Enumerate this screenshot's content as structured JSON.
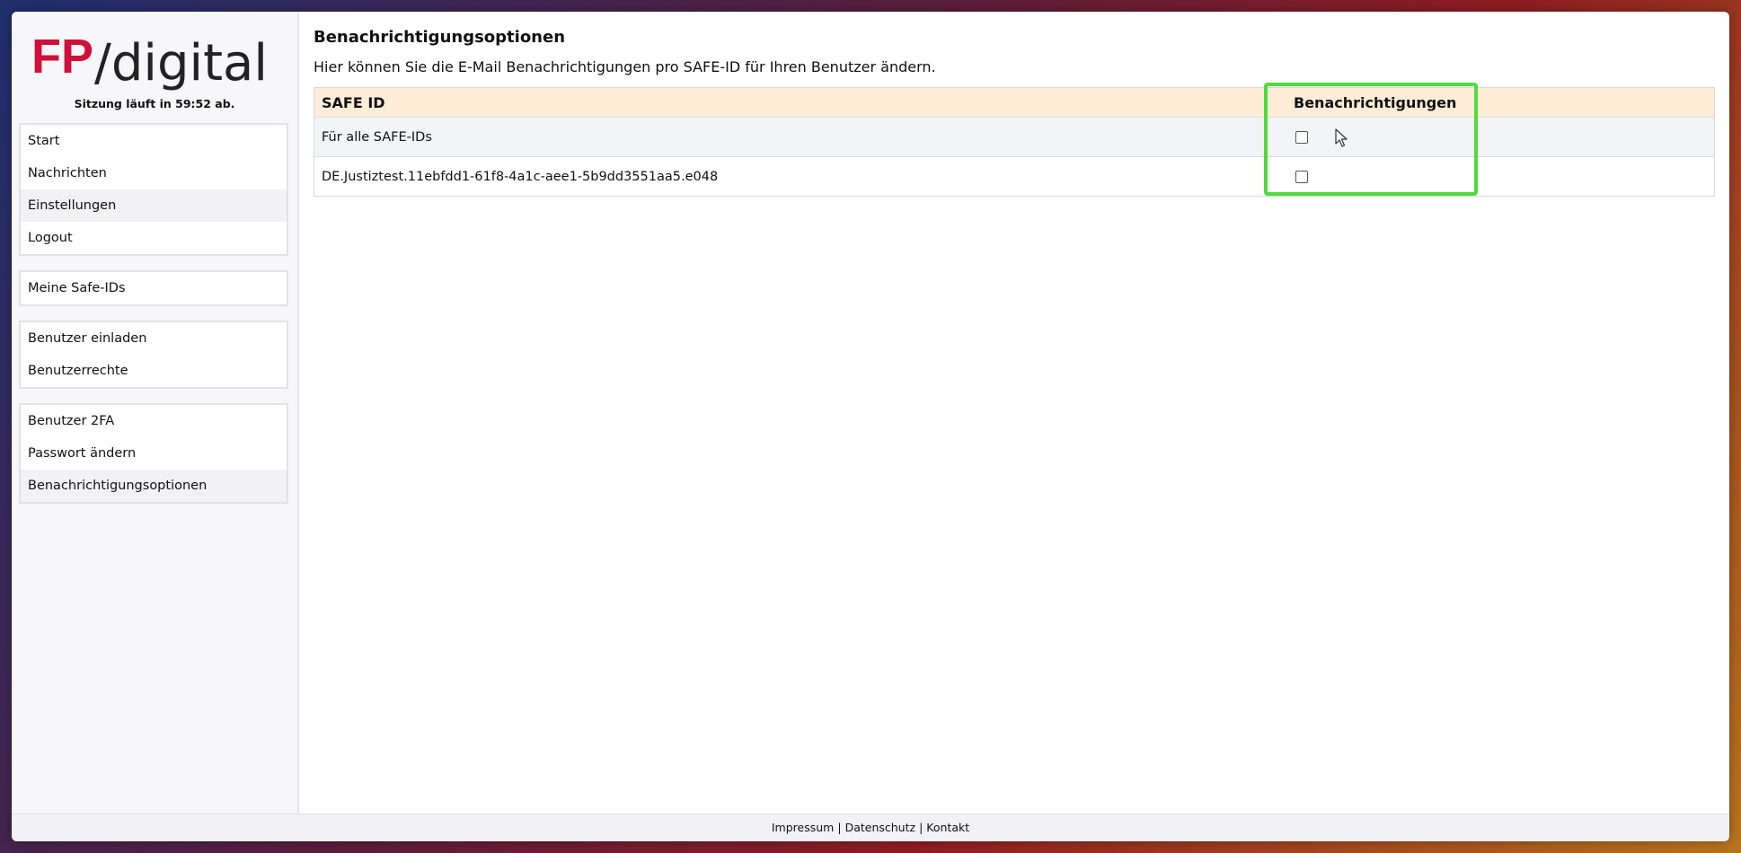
{
  "brand": {
    "logo_mark": "FP",
    "logo_text": "/digital",
    "accent_color": "#d0103a"
  },
  "session": {
    "text": "Sitzung läuft in 59:52 ab."
  },
  "sidebar": {
    "group1": [
      "Start",
      "Nachrichten",
      "Einstellungen",
      "Logout"
    ],
    "group2": [
      "Meine Safe-IDs"
    ],
    "group3": [
      "Benutzer einladen",
      "Benutzerrechte"
    ],
    "group4": [
      "Benutzer 2FA",
      "Passwort ändern",
      "Benachrichtigungsoptionen"
    ]
  },
  "main": {
    "title": "Benachrichtigungsoptionen",
    "description": "Hier können Sie die E-Mail Benachrichtigungen pro SAFE-ID für Ihren Benutzer ändern.",
    "table": {
      "col_id": "SAFE ID",
      "col_notif": "Benachrichtigungen",
      "rows": [
        {
          "id": "Für alle SAFE-IDs",
          "checked": false
        },
        {
          "id": "DE.Justiztest.11ebfdd1-61f8-4a1c-aee1-5b9dd3551aa5.e048",
          "checked": false
        }
      ]
    }
  },
  "footer": {
    "impressum": "Impressum",
    "datenschutz": "Datenschutz",
    "kontakt": "Kontakt",
    "separator": "|"
  }
}
